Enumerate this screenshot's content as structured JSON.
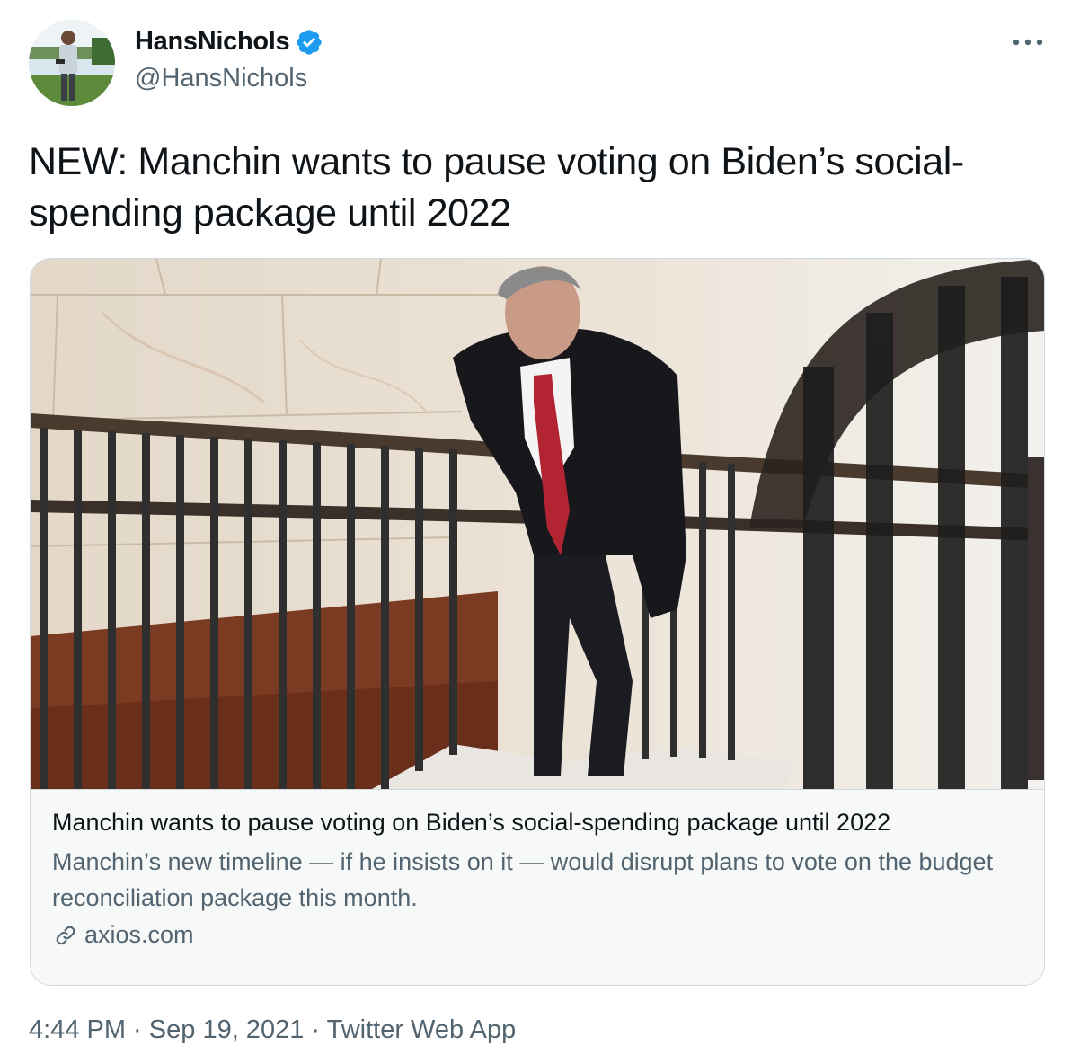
{
  "author": {
    "display_name": "HansNichols",
    "handle": "@HansNichols",
    "verified": true,
    "verified_color": "#1d9bf0"
  },
  "tweet": {
    "text": "NEW: Manchin wants to pause voting on Biden’s social-spending package until 2022"
  },
  "card": {
    "title": "Manchin wants to pause voting on Biden’s social-spending package until 2022",
    "description": "Manchin’s new timeline — if he insists on it — would disrupt plans to vote on the budget reconciliation package this month.",
    "domain": "axios.com",
    "domain_icon": "link-icon"
  },
  "meta": {
    "time": "4:44 PM",
    "separator": " · ",
    "date": "Sep 19, 2021",
    "source": "Twitter Web App"
  },
  "colors": {
    "text_primary": "#0f1419",
    "text_secondary": "#536471",
    "border": "#cfd9de",
    "card_bg": "#f7f9f9"
  }
}
